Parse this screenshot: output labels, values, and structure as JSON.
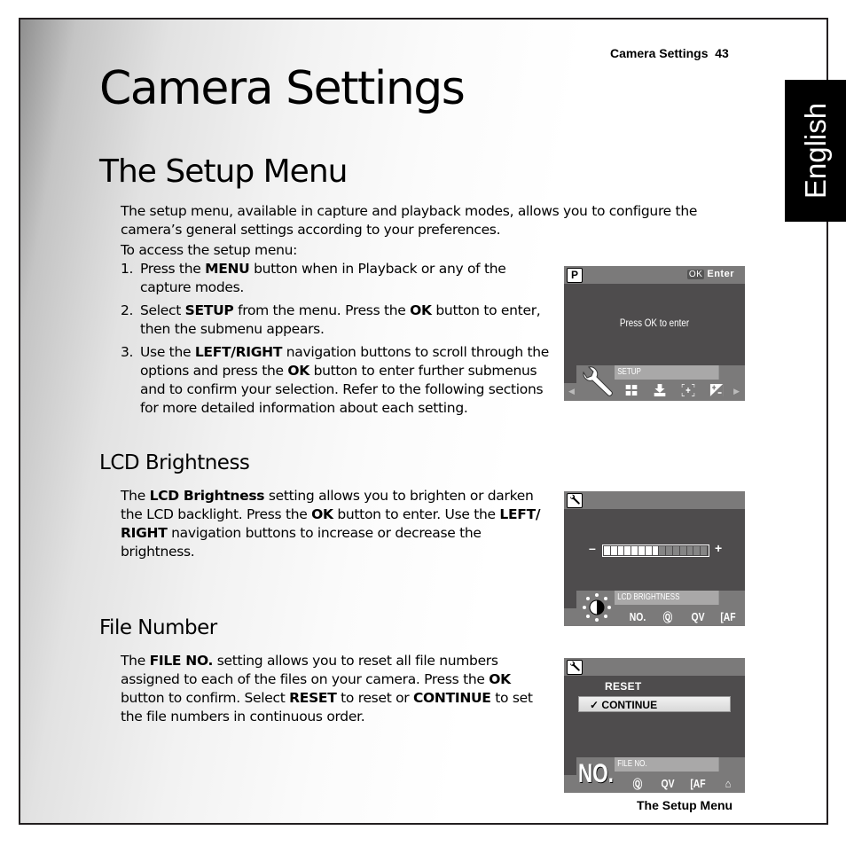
{
  "header": {
    "running_title": "Camera Settings",
    "page_number": "43"
  },
  "language_tab": "English",
  "title": "Camera Settings",
  "section": {
    "title": "The Setup Menu",
    "intro": "The setup menu, available in capture and playback modes, allows you to configure the camera’s general settings according to your preferences.",
    "access_lead": "To access the setup menu:",
    "steps": [
      {
        "num": "1.",
        "parts": [
          "Press the ",
          {
            "b": "MENU"
          },
          " button when in Playback or any of the capture modes."
        ]
      },
      {
        "num": "2.",
        "parts": [
          "Select ",
          {
            "b": "SETUP"
          },
          " from the menu. Press the ",
          {
            "b": "OK"
          },
          " button to enter, then the submenu appears."
        ]
      },
      {
        "num": "3.",
        "parts": [
          "Use the ",
          {
            "b": "LEFT/RIGHT"
          },
          " navigation buttons to scroll through the options and press the ",
          {
            "b": "OK"
          },
          " button to enter further submenus and to confirm your selection. Refer to the following sections for more detailed information about each setting."
        ]
      }
    ]
  },
  "lcd": {
    "title": "LCD Brightness",
    "parts": [
      "The ",
      {
        "b": "LCD Brightness"
      },
      " setting allows you to brighten or darken the LCD backlight. Press the ",
      {
        "b": "OK"
      },
      " button to enter. Use the ",
      {
        "b": "LEFT/ RIGHT"
      },
      " navigation buttons to increase or decrease the brightness."
    ]
  },
  "fileno": {
    "title": "File Number",
    "parts": [
      "The ",
      {
        "b": "FILE NO."
      },
      " setting allows you to reset all file numbers assigned to each of the files on your camera. Press the ",
      {
        "b": "OK"
      },
      " button to confirm. Select ",
      {
        "b": "RESET"
      },
      " to reset or ",
      {
        "b": "CONTINUE"
      },
      " to set the file numbers in continuous order."
    ]
  },
  "screen1": {
    "mode_icon": "P",
    "ok_badge": "OK",
    "ok_label": "Enter",
    "center_text": "Press OK to enter",
    "label": "SETUP",
    "big_icon": "wrench-icon",
    "icons": [
      "image-size-icon",
      "quality-icon",
      "focus-icon",
      "exposure-icon"
    ],
    "left_arrow": "◀",
    "right_arrow": "▶"
  },
  "screen2": {
    "header_icon": "wrench-icon",
    "minus": "–",
    "plus": "+",
    "brightness": {
      "level": 8,
      "max": 15
    },
    "label": "LCD BRIGHTNESS",
    "big_icon": "brightness-icon",
    "icons": [
      "NO.",
      "Ⓠ",
      "QV",
      "[AF"
    ]
  },
  "screen3": {
    "header_icon": "wrench-icon",
    "options": [
      "RESET",
      "CONTINUE"
    ],
    "selected": "CONTINUE",
    "check": "✓",
    "label": "FILE NO.",
    "big_icon_text": "NO.",
    "icons": [
      "Ⓠ",
      "QV",
      "[AF",
      "⌂"
    ]
  },
  "caption": "The Setup Menu"
}
